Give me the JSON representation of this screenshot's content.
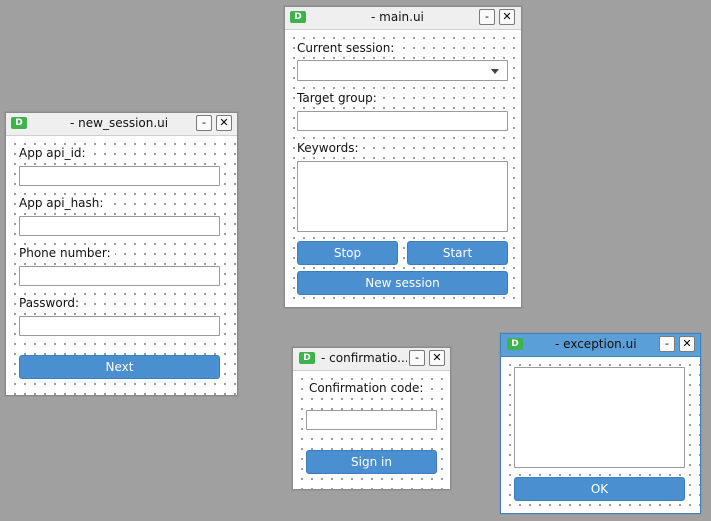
{
  "windows": {
    "main": {
      "title": "- main.ui",
      "labels": {
        "current_session": "Current session:",
        "target_group": "Target group:",
        "keywords": "Keywords:"
      },
      "buttons": {
        "stop": "Stop",
        "start": "Start",
        "new_session": "New session"
      }
    },
    "new_session": {
      "title": "- new_session.ui",
      "labels": {
        "api_id": "App api_id:",
        "api_hash": "App api_hash:",
        "phone": "Phone number:",
        "password": "Password:"
      },
      "buttons": {
        "next": "Next"
      }
    },
    "confirmation": {
      "title": "- confirmatio...",
      "labels": {
        "code": "Confirmation code:"
      },
      "buttons": {
        "sign_in": "Sign in"
      }
    },
    "exception": {
      "title": "- exception.ui",
      "buttons": {
        "ok": "OK"
      }
    }
  },
  "titlebar_buttons": {
    "minimize": "-",
    "close": "✕"
  },
  "app_icon_glyph": "D",
  "colors": {
    "desktop": "#a0a0a0",
    "button_blue": "#4a8fd0",
    "active_titlebar": "#5b9fd9",
    "app_icon_green": "#3cb44b"
  }
}
